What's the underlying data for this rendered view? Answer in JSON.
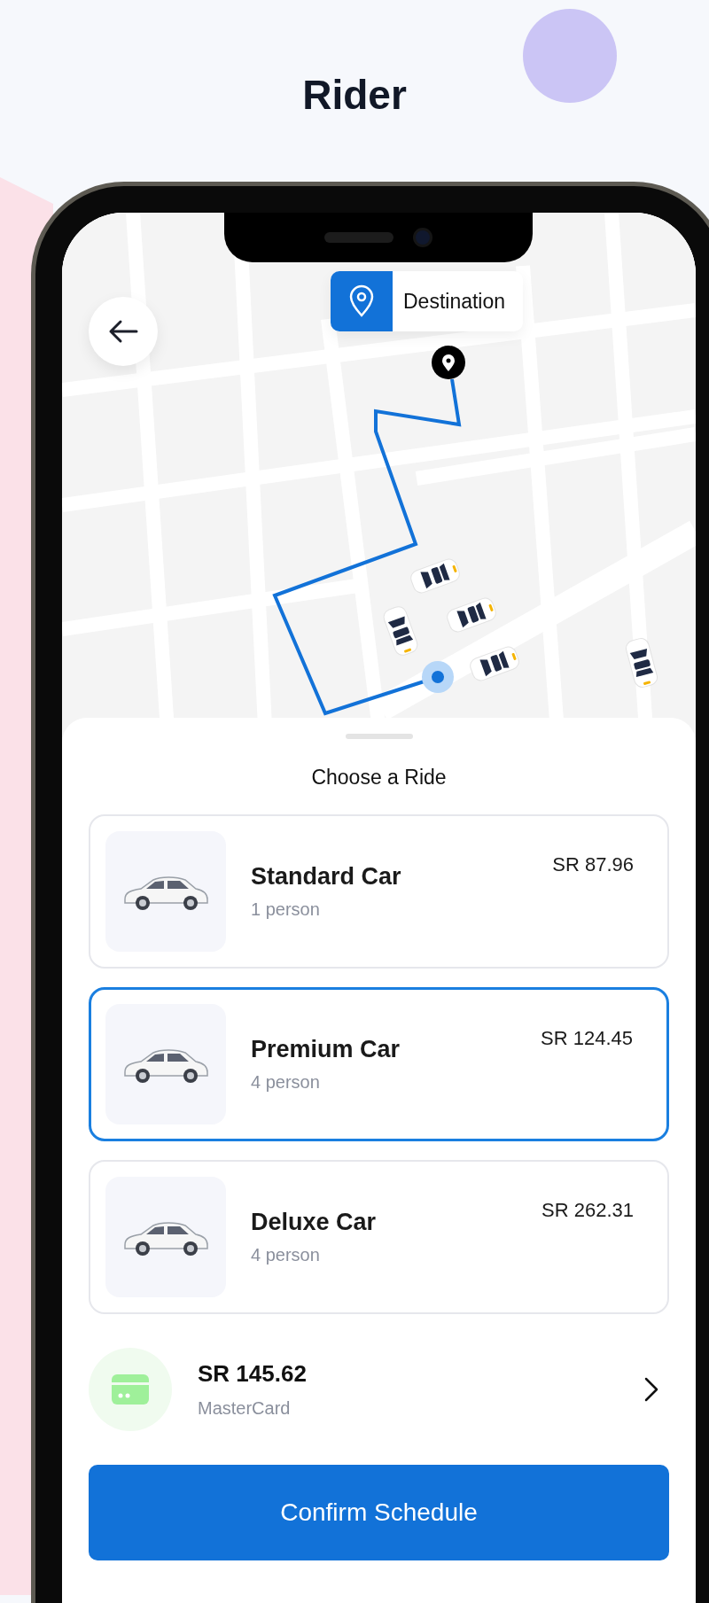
{
  "page_title": "Rider",
  "map": {
    "destination_label": "Destination"
  },
  "sheet": {
    "title": "Choose a Ride"
  },
  "rides": [
    {
      "name": "Standard Car",
      "capacity": "1 person",
      "price": "SR 87.96",
      "selected": false
    },
    {
      "name": "Premium Car",
      "capacity": "4 person",
      "price": "SR 124.45",
      "selected": true
    },
    {
      "name": "Deluxe Car",
      "capacity": "4 person",
      "price": "SR 262.31",
      "selected": false
    }
  ],
  "payment": {
    "amount": "SR 145.62",
    "method": "MasterCard"
  },
  "confirm_button": "Confirm Schedule"
}
